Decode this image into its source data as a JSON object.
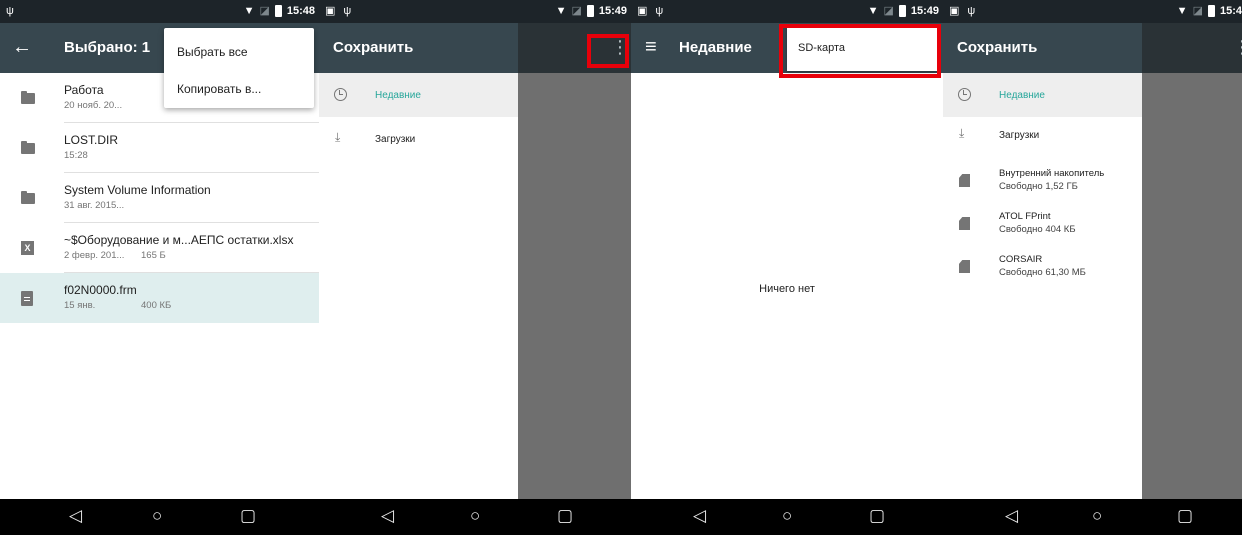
{
  "status": {
    "time1": "15:48",
    "time2": "15:49",
    "time3": "15:49",
    "time4": "15:4"
  },
  "panel1": {
    "title": "Выбрано: 1",
    "menu": [
      "Выбрать все",
      "Копировать в..."
    ],
    "files": [
      {
        "name": "Работа",
        "sub": "20 нояб. 20...",
        "size": "",
        "icon": "folder-icon"
      },
      {
        "name": "LOST.DIR",
        "sub": "15:28",
        "size": "",
        "icon": "folder-icon"
      },
      {
        "name": "System Volume Information",
        "sub": "31 авг. 2015...",
        "size": "",
        "icon": "folder-icon"
      },
      {
        "name": "~$Оборудование и м...АЕПС остатки.xlsx",
        "sub": "2 февр. 201...",
        "size": "165 Б",
        "icon": "excel-file-icon"
      },
      {
        "name": "f02N0000.frm",
        "sub": "15 янв.",
        "size": "400 КБ",
        "icon": "document-icon"
      }
    ]
  },
  "panel2": {
    "title": "Сохранить",
    "drawer": [
      "Недавние",
      "Загрузки"
    ]
  },
  "panel3": {
    "title": "Недавние",
    "sd_label": "SD-карта",
    "empty_text": "Ничего нет"
  },
  "panel4": {
    "title": "Сохранить",
    "recent": "Недавние",
    "downloads": "Загрузки",
    "storages": [
      {
        "name": "Внутренний накопитель",
        "free": "Свободно 1,52 ГБ"
      },
      {
        "name": "ATOL FPrint",
        "free": "Свободно 404 КБ"
      },
      {
        "name": "CORSAIR",
        "free": "Свободно 61,30 МБ"
      }
    ]
  },
  "colors": {
    "toolbar": "#37474f",
    "accent": "#26a69a",
    "highlight": "#e8000a"
  },
  "icons": {
    "usb": "usb-icon",
    "wifi": "wifi-icon",
    "battery": "battery-icon",
    "back": "back-arrow-icon",
    "menu": "hamburger-menu-icon",
    "overflow": "overflow-menu-icon"
  },
  "glyphs": {
    "usb": "ψ",
    "screenshot": "▣",
    "wifi": "▼",
    "nosim": "◪",
    "back_arrow": "←",
    "menu": "≡",
    "overflow": "⋮",
    "download": "⤓",
    "nav_back": "◁",
    "nav_home": "○",
    "nav_recent": "▢"
  }
}
